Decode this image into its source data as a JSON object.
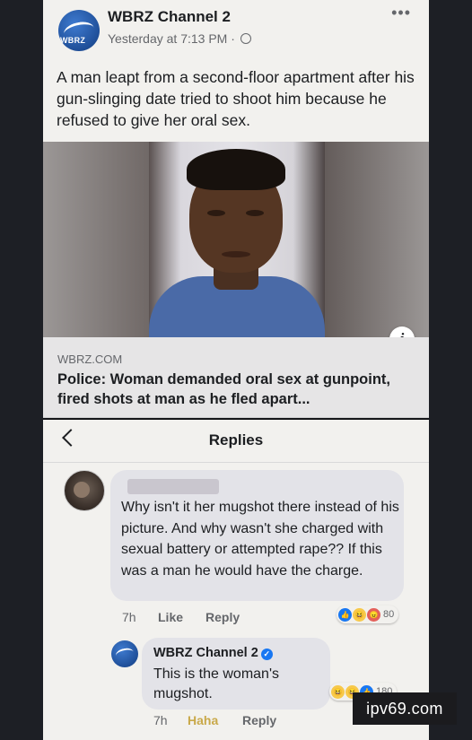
{
  "post": {
    "page_name": "WBRZ Channel 2",
    "avatar_brand": "WBRZ",
    "timestamp": "Yesterday at 7:13 PM ·",
    "more_label": "•••",
    "text": "A man leapt from a second-floor apartment after his gun-slinging date tried to shoot him because he refused to give her oral sex.",
    "image_icon_name": "mugshot-photo",
    "info_label": "i",
    "link": {
      "domain": "WBRZ.COM",
      "title": "Police: Woman demanded oral sex at gunpoint, fired shots at man as he fled apart..."
    }
  },
  "replies": {
    "title": "Replies",
    "comment": {
      "text": "Why isn't it her mugshot there instead of his picture. And why wasn't she charged with sexual battery or attempted rape?? If this was a man he would have the charge.",
      "time": "7h",
      "like_label": "Like",
      "reply_label": "Reply",
      "reaction_count": "80"
    },
    "reply": {
      "author": "WBRZ Channel 2",
      "text": "This is the woman's mugshot.",
      "time": "7h",
      "reaction_label": "Haha",
      "reply_label": "Reply",
      "reaction_count": "180"
    }
  },
  "watermark": "ipv69.com",
  "colors": {
    "background": "#15161a",
    "card": "#f2f1ee",
    "bubble": "#e3e3e8",
    "facebook_blue": "#1877f2",
    "haha": "#c9a94a"
  }
}
